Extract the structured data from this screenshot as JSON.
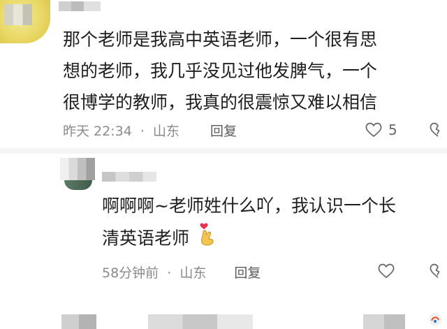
{
  "comments": [
    {
      "lines": [
        "那个老师是我高中英语老师，一个很有思",
        "想的老师，我几乎没见过他发脾气，一个",
        "很博学的教师，我真的很震惊又难以相信"
      ],
      "time": "昨天 22:34",
      "separator": "·",
      "location": "山东",
      "reply_label": "回复",
      "likes": "5"
    }
  ],
  "reply": {
    "lines": [
      "啊啊啊~老师姓什么吖，我认识一个长",
      "清英语老师"
    ],
    "time": "58分钟前",
    "separator": "·",
    "location": "山东",
    "reply_label": "回复",
    "emoji": "heart-hands-emoji"
  },
  "colors": {
    "text": "#1e1e1e",
    "meta": "#8a8a8a",
    "icon": "#6a6a6a",
    "emoji_heart": "#e8344e",
    "emoji_hand": "#f5c44e"
  }
}
